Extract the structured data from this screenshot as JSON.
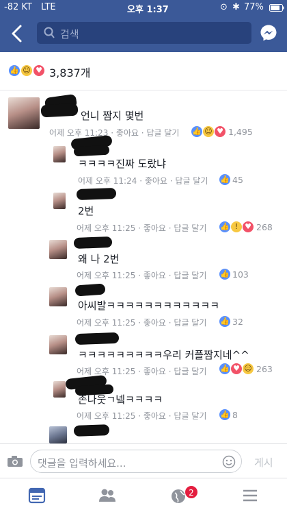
{
  "status_bar": {
    "signal": "-82 KT",
    "carrier": "LTE",
    "time": "오후 1:37",
    "battery": "77%"
  },
  "header": {
    "search_placeholder": "검색",
    "back_icon": "back-chevron-icon",
    "messenger_icon": "messenger-icon"
  },
  "reactions_summary": {
    "count": "3,837개",
    "types": [
      "like",
      "haha",
      "love"
    ]
  },
  "comments": [
    {
      "text": "언니 짬지 몇번",
      "timestamp": "어제 오후 11:23",
      "like_label": "좋아요",
      "reply_label": "답글 달기",
      "reactions": [
        "like",
        "haha",
        "love"
      ],
      "count": "1,495"
    },
    {
      "text": "ㅋㅋㅋㅋ진짜 도랐냐",
      "timestamp": "어제 오후 11:24",
      "like_label": "좋아요",
      "reply_label": "답글 달기",
      "reactions": [
        "like"
      ],
      "count": "45"
    },
    {
      "text": "2번",
      "timestamp": "어제 오후 11:25",
      "like_label": "좋아요",
      "reply_label": "답글 달기",
      "reactions": [
        "like",
        "wow",
        "love"
      ],
      "count": "268"
    },
    {
      "text": "왜 나 2번",
      "timestamp": "어제 오후 11:25",
      "like_label": "좋아요",
      "reply_label": "답글 달기",
      "reactions": [
        "like"
      ],
      "count": "103"
    },
    {
      "text": "아씨발ㅋㅋㅋㅋㅋㅋㅋㅋㅋㅋㅋㅋ",
      "timestamp": "어제 오후 11:25",
      "like_label": "좋아요",
      "reply_label": "답글 달기",
      "reactions": [
        "like"
      ],
      "count": "32"
    },
    {
      "text": "ㅋㅋㅋㅋㅋㅋㅋㅋㅋ우리 커플짬지네^^",
      "timestamp": "어제 오후 11:25",
      "like_label": "좋아요",
      "reply_label": "답글 달기",
      "reactions": [
        "like",
        "love",
        "haha"
      ],
      "count": "263"
    },
    {
      "text": "존나웃ㄱ넼ㅋㅋㅋㅋ",
      "timestamp": "어제 오후 11:25",
      "like_label": "좋아요",
      "reply_label": "답글 달기",
      "reactions": [
        "like"
      ],
      "count": "8"
    }
  ],
  "composer": {
    "placeholder": "댓글을 입력하세요...",
    "post_label": "게시"
  },
  "tabbar": {
    "notifications_badge": "2"
  },
  "colors": {
    "brand": "#3b5998",
    "like": "#5890ff",
    "love": "#f25268",
    "haha": "#f7c841",
    "meta": "#90949c"
  }
}
